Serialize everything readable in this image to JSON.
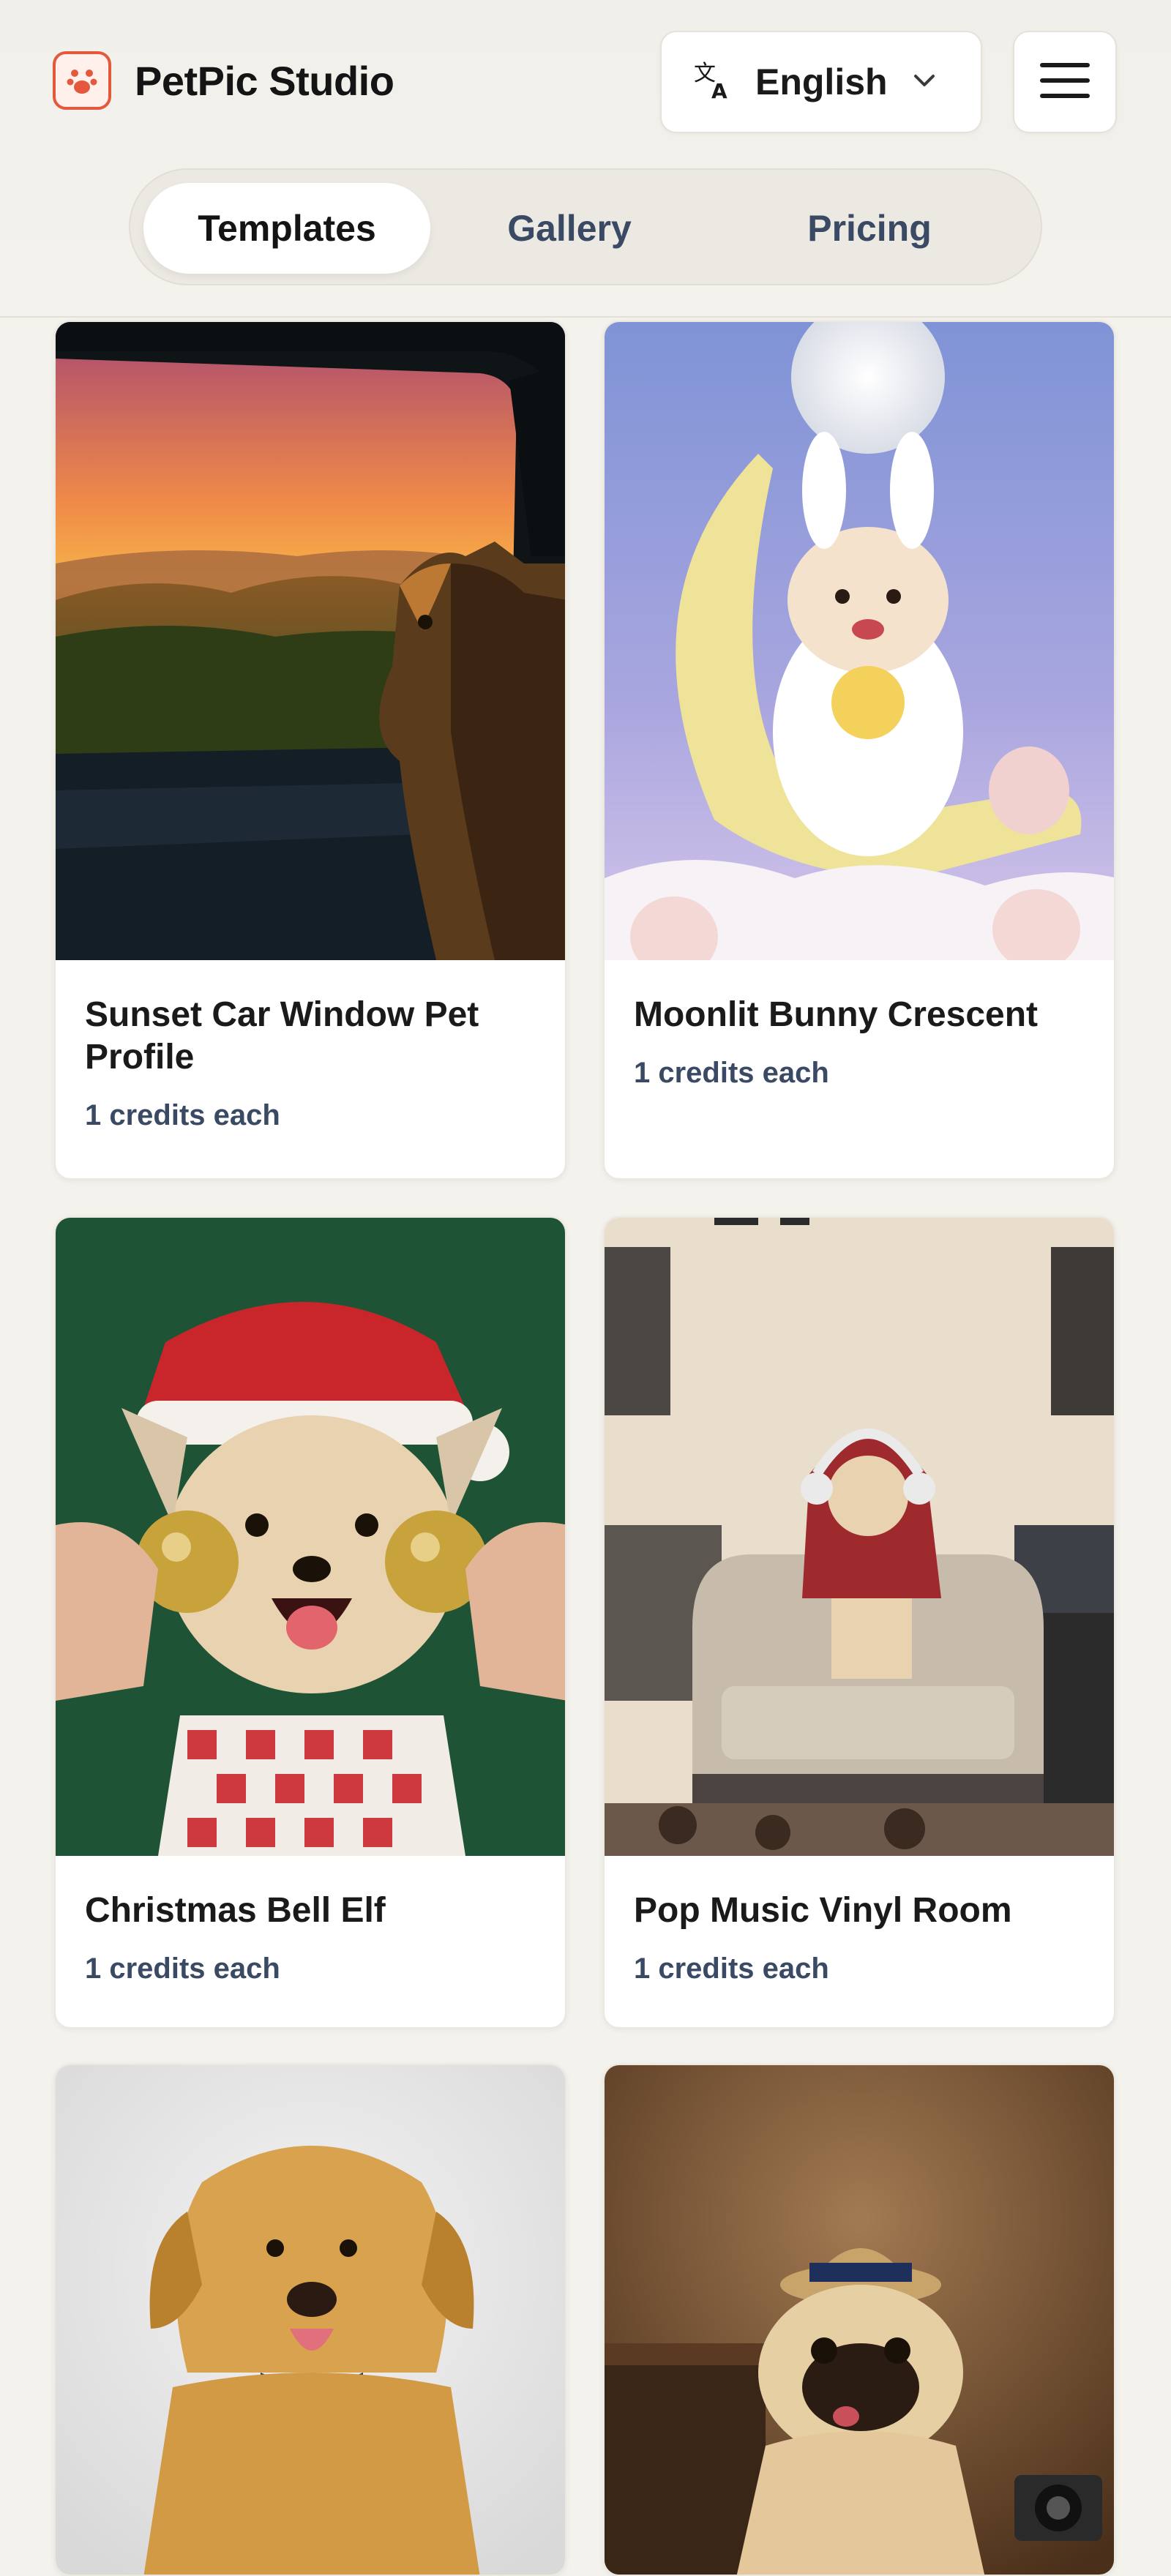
{
  "header": {
    "brand_name": "PetPic Studio",
    "brand_icon": "paw-icon",
    "language": {
      "icon": "translate-icon",
      "selected": "English",
      "chevron_icon": "chevron-down-icon"
    },
    "menu_icon": "hamburger-menu-icon",
    "tabs": [
      {
        "label": "Templates",
        "active": true
      },
      {
        "label": "Gallery",
        "active": false
      },
      {
        "label": "Pricing",
        "active": false
      }
    ]
  },
  "templates": [
    {
      "title": "Sunset Car Window Pet Profile",
      "credits": "1 credits each"
    },
    {
      "title": "Moonlit Bunny Crescent",
      "credits": "1 credits each"
    },
    {
      "title": "Christmas Bell Elf",
      "credits": "1 credits each"
    },
    {
      "title": "Pop Music Vinyl Room",
      "credits": "1 credits each"
    },
    {
      "title": "",
      "credits": ""
    },
    {
      "title": "",
      "credits": ""
    }
  ],
  "colors": {
    "accent": "#e4583e",
    "background": "#f4f2ed",
    "muted_text": "#3b4a64"
  }
}
